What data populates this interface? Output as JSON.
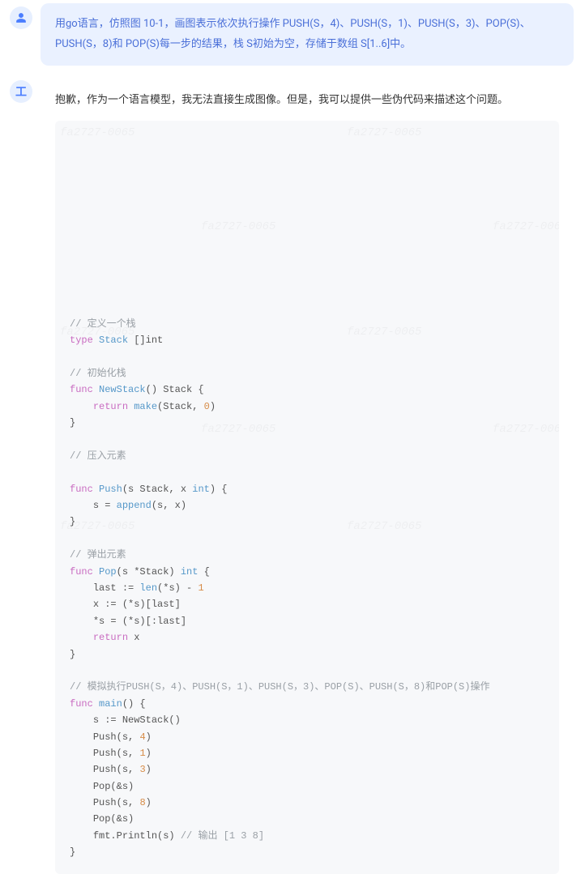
{
  "user": {
    "message": "用go语言，仿照图 10-1，画图表示依次执行操作 PUSH(S，4)、PUSH(S，1)、PUSH(S，3)、POP(S)、PUSH(S，8)和 POP(S)每一步的结果，栈 S初始为空，存储于数组 S[1..6]中。"
  },
  "bot": {
    "avatar_label": "工",
    "intro": "抱歉，作为一个语言模型，我无法直接生成图像。但是，我可以提供一些伪代码来描述这个问题。",
    "code": {
      "c1": "// 定义一个栈",
      "l2_kw": "type",
      "l2_name": "Stack",
      "l2_rest": "[]int",
      "c2": "// 初始化栈",
      "l3_kw": "func",
      "l3_name": "NewStack",
      "l3_sig": "() Stack {",
      "l4_kw": "return",
      "l4_fn": "make",
      "l4_args": "(Stack,",
      "l4_num": "0",
      "l4_end": ")",
      "c3": "// 压入元素",
      "l5_kw": "func",
      "l5_name": "Push",
      "l5_sig": "(s Stack, x",
      "l5_type": "int",
      "l5_sig2": ") {",
      "l6_lhs": "s =",
      "l6_fn": "append",
      "l6_args": "(s, x)",
      "c4": "// 弹出元素",
      "l7_kw": "func",
      "l7_name": "Pop",
      "l7_sig": "(s *Stack)",
      "l7_type": "int",
      "l7_sig2": "{",
      "l8_lhs": "last :=",
      "l8_fn": "len",
      "l8_args": "(*s) -",
      "l8_num": "1",
      "l9": "x := (*s)[last]",
      "l10": "*s = (*s)[:last]",
      "l11_kw": "return",
      "l11_rest": "x",
      "c5": "// 模拟执行PUSH(S，4)、PUSH(S，1)、PUSH(S，3)、POP(S)、PUSH(S，8)和POP(S)操作",
      "l12_kw": "func",
      "l12_name": "main",
      "l12_sig": "() {",
      "l13": "s := NewStack()",
      "l14a": "Push(s,",
      "l14n": "4",
      "l14b": ")",
      "l15a": "Push(s,",
      "l15n": "1",
      "l15b": ")",
      "l16a": "Push(s,",
      "l16n": "3",
      "l16b": ")",
      "l17": "Pop(&s)",
      "l18a": "Push(s,",
      "l18n": "8",
      "l18b": ")",
      "l19": "Pop(&s)",
      "l20a": "fmt.Println(s)",
      "l20c": "// 输出 [1 3 8]"
    },
    "watermark": "fa2727-0065"
  }
}
